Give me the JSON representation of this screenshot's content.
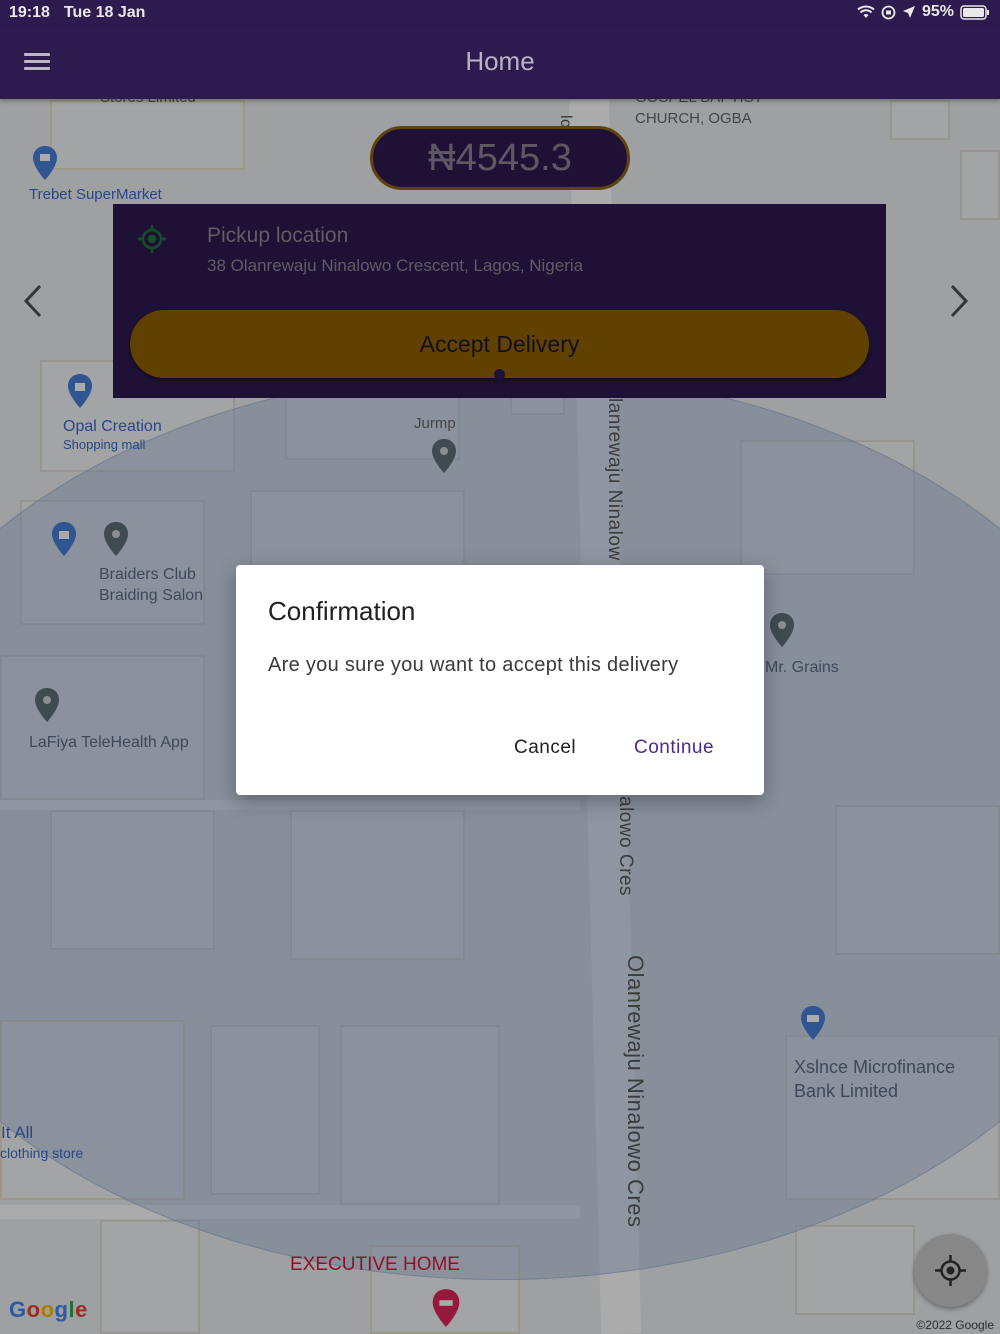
{
  "status_bar": {
    "time": "19:18",
    "date": "Tue 18 Jan",
    "battery": "95%"
  },
  "app_bar": {
    "title": "Home",
    "menu_icon": "hamburger-menu-icon"
  },
  "price": {
    "amount": "₦4545.3"
  },
  "pickup": {
    "label": "Pickup location",
    "address": "38 Olanrewaju Ninalowo Crescent, Lagos, Nigeria",
    "accept_label": "Accept Delivery"
  },
  "map": {
    "labels": {
      "stores": "Stores Limited",
      "church": "GOSPEL BAPTIST\nCHURCH, OGBA",
      "trebet": "Trebet SuperMarket",
      "opal": "Opal Creation",
      "opal_sub": "Shopping mall",
      "jurmp": "Jurmp",
      "braiders": "Braiders Club\nBraiding Salon",
      "mr_grains": "Mr. Grains",
      "lafiya": "LaFiya TeleHealth App",
      "it_all": "It All",
      "it_all_sub": "clothing store",
      "xslnce": "Xslnce Microfinance\nBank Limited",
      "exec_home": "EXECUTIVE HOME",
      "road_top": "lanrewaju Ninalow",
      "road_mid": "alowo Cres",
      "road_bottom": "Olanrewaju Ninalowo Cres",
      "road_top_short": "low"
    },
    "google_logo": "Google",
    "attribution": "©2022 Google"
  },
  "dialog": {
    "title": "Confirmation",
    "message": "Are you sure you want to accept this delivery",
    "cancel": "Cancel",
    "continue": "Continue"
  },
  "colors": {
    "primary": "#2d1a4f",
    "accent": "#f5a800",
    "dialog_action": "#4e2a8a"
  }
}
